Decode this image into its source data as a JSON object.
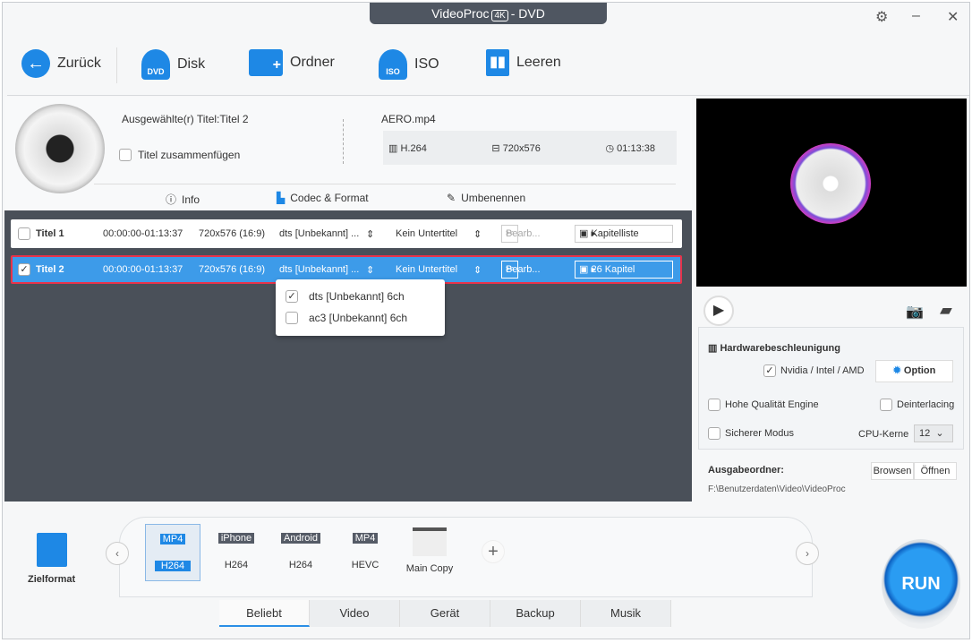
{
  "window": {
    "title": "VideoProc",
    "title_badge": "4K",
    "title_suffix": "- DVD"
  },
  "toolbar": {
    "back": "Zurück",
    "disk": "Disk",
    "folder": "Ordner",
    "iso": "ISO",
    "clear": "Leeren"
  },
  "info": {
    "selected_title": "Ausgewählte(r) Titel:Titel 2",
    "merge_titles": "Titel zusammenfügen",
    "filename": "AERO.mp4",
    "codec": "H.264",
    "resolution": "720x576",
    "duration": "01:13:38",
    "tabs": [
      "Info",
      "Codec & Format",
      "Umbenennen"
    ]
  },
  "titles": [
    {
      "name": "Titel 1",
      "checked": false,
      "range": "00:00:00-01:13:37",
      "res": "720x576 (16:9)",
      "audio": "dts [Unbekannt] ...",
      "subtitle": "Kein Untertitel",
      "edit": "Bearb...",
      "chapters": "Kapitelliste"
    },
    {
      "name": "Titel 2",
      "checked": true,
      "range": "00:00:00-01:13:37",
      "res": "720x576 (16:9)",
      "audio": "dts [Unbekannt] ...",
      "subtitle": "Kein Untertitel",
      "edit": "Bearb...",
      "chapters": "26 Kapitel"
    }
  ],
  "audio_dropdown": [
    {
      "label": "dts [Unbekannt] 6ch",
      "checked": true
    },
    {
      "label": "ac3 [Unbekannt] 6ch",
      "checked": false
    }
  ],
  "settings": {
    "hw_title": "Hardwarebeschleunigung",
    "hw_option": "Nvidia / Intel / AMD",
    "option_button": "Option",
    "high_quality": "Hohe Qualität Engine",
    "deinterlacing": "Deinterlacing",
    "safe_mode": "Sicherer Modus",
    "cpu_label": "CPU-Kerne",
    "cpu_value": "12",
    "output_label": "Ausgabeordner:",
    "browse": "Browsen",
    "open": "Öffnen",
    "output_path": "F:\\Benutzerdaten\\Video\\VideoProc"
  },
  "formats": {
    "label": "Zielformat",
    "items": [
      {
        "tag": "MP4",
        "sub": "H264"
      },
      {
        "tag": "iPhone",
        "sub": "H264"
      },
      {
        "tag": "Android",
        "sub": "H264"
      },
      {
        "tag": "MP4",
        "sub": "HEVC"
      },
      {
        "tag": "",
        "sub": "Main Copy"
      }
    ]
  },
  "bottom_tabs": [
    "Beliebt",
    "Video",
    "Gerät",
    "Backup",
    "Musik"
  ],
  "run": "RUN",
  "colors": {
    "accent": "#2b8ee6",
    "selected_row": "#3d9be9",
    "list_bg": "#4a5059"
  }
}
